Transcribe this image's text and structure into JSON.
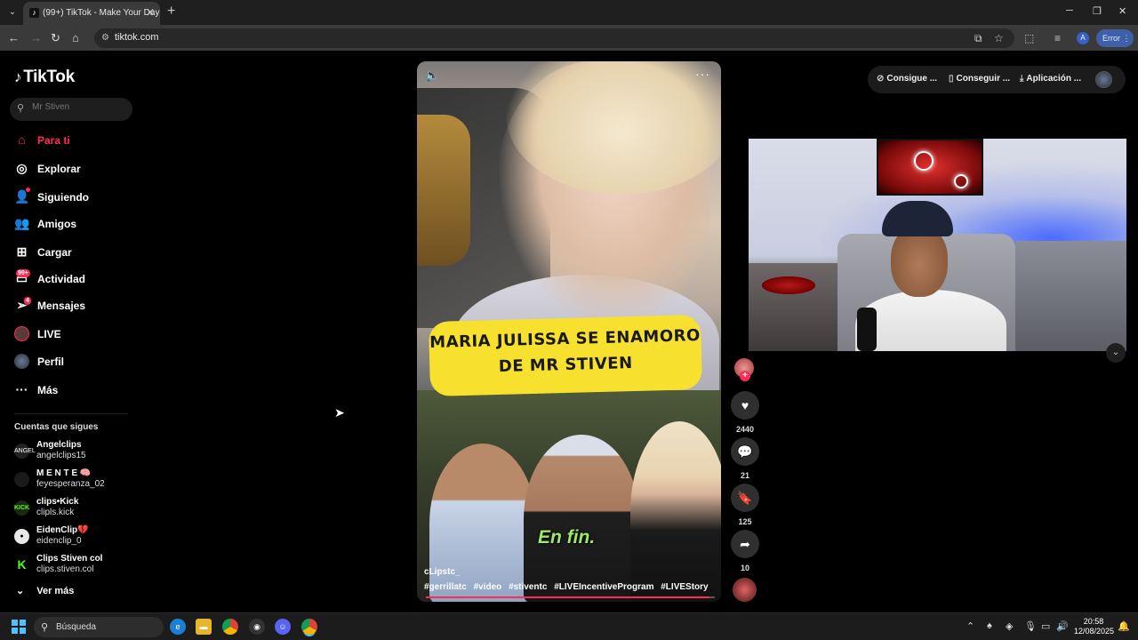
{
  "browser": {
    "tab_title": "(99+) TikTok - Make Your Day",
    "url": "tiktok.com",
    "error_label": "Error",
    "profile_initial": "A"
  },
  "tiktok": {
    "logo": "TikTok",
    "search_placeholder": "Mr Stiven",
    "menu": [
      {
        "label": "Para ti",
        "icon": "home-icon",
        "active": true
      },
      {
        "label": "Explorar",
        "icon": "compass-icon"
      },
      {
        "label": "Siguiendo",
        "icon": "user-plus-icon"
      },
      {
        "label": "Amigos",
        "icon": "users-icon"
      },
      {
        "label": "Cargar",
        "icon": "upload-icon"
      },
      {
        "label": "Actividad",
        "icon": "inbox-icon",
        "badge": "99+"
      },
      {
        "label": "Mensajes",
        "icon": "send-icon",
        "badge": "4"
      },
      {
        "label": "LIVE",
        "icon": "live-icon"
      },
      {
        "label": "Perfil",
        "icon": "profile-icon"
      },
      {
        "label": "Más",
        "icon": "more-icon"
      }
    ],
    "follows_title": "Cuentas que sigues",
    "follows": [
      {
        "name": "Angelclips",
        "handle": "angelclips15"
      },
      {
        "name": "M E N T E 🧠",
        "handle": "feyesperanza_02"
      },
      {
        "name": "clips•Kick",
        "handle": "clipls.kick"
      },
      {
        "name": "EidenClip💔",
        "handle": "eidenclip_0"
      },
      {
        "name": "Clips Stiven col",
        "handle": "clips.stiven.col"
      }
    ],
    "more_follows": "Ver más",
    "header_buttons": [
      "Consigue ...",
      "Conseguir ...",
      "Aplicación ..."
    ]
  },
  "video": {
    "banner_line1": "MARIA JULISSA SE ENAMORO",
    "banner_line2": "DE MR STIVEN",
    "subtitle": "En fin.",
    "author": "cLipstc_",
    "hashtags": [
      "#gerrillatc",
      "#video",
      "#stiventc",
      "#LIVEIncentiveProgram",
      "#LIVEStory"
    ],
    "progress": 0.98,
    "likes": "2440",
    "comments": "21",
    "saves": "125",
    "shares": "10"
  },
  "taskbar": {
    "search_label": "Búsqueda",
    "time": "20:58",
    "date": "12/08/2025"
  },
  "colors": {
    "accent": "#fe2c55",
    "banner": "#f7e12e"
  }
}
